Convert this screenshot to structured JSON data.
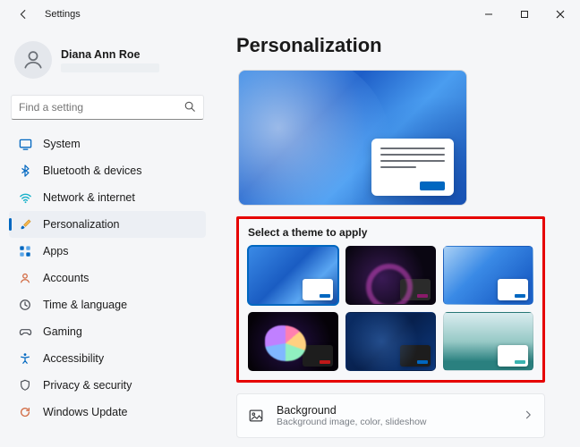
{
  "titlebar": {
    "title": "Settings"
  },
  "user": {
    "name": "Diana Ann Roe"
  },
  "search": {
    "placeholder": "Find a setting"
  },
  "nav": {
    "items": [
      {
        "label": "System"
      },
      {
        "label": "Bluetooth & devices"
      },
      {
        "label": "Network & internet"
      },
      {
        "label": "Personalization"
      },
      {
        "label": "Apps"
      },
      {
        "label": "Accounts"
      },
      {
        "label": "Time & language"
      },
      {
        "label": "Gaming"
      },
      {
        "label": "Accessibility"
      },
      {
        "label": "Privacy & security"
      },
      {
        "label": "Windows Update"
      }
    ]
  },
  "main": {
    "heading": "Personalization",
    "themes_header": "Select a theme to apply",
    "background_row": {
      "title": "Background",
      "subtitle": "Background image, color, slideshow"
    }
  }
}
